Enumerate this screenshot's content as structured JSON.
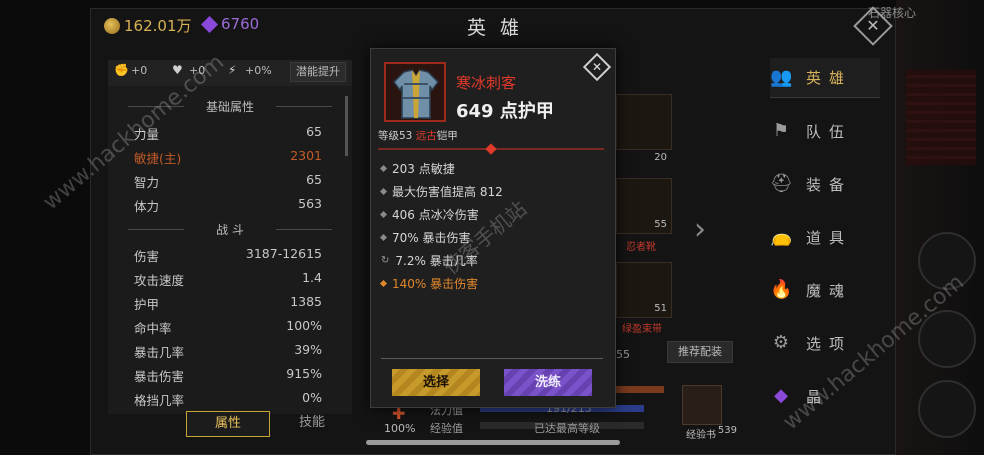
{
  "header": {
    "coins": "162.01万",
    "gems": "6760",
    "title": "英 雄",
    "corner_text": "石器核心"
  },
  "left_panel": {
    "chips": [
      "+0",
      "+0",
      "+0%"
    ],
    "potential_button": "潜能提升",
    "basic_section": "基础属性",
    "basic": [
      {
        "k": "力量",
        "v": "65"
      },
      {
        "k": "敏捷(主)",
        "v": "2301"
      },
      {
        "k": "智力",
        "v": "65"
      },
      {
        "k": "体力",
        "v": "563"
      }
    ],
    "combat_section": "战 斗",
    "combat": [
      {
        "k": "伤害",
        "v": "3187-12615"
      },
      {
        "k": "攻击速度",
        "v": "1.4"
      },
      {
        "k": "护甲",
        "v": "1385"
      },
      {
        "k": "命中率",
        "v": "100%"
      },
      {
        "k": "暴击几率",
        "v": "39%"
      },
      {
        "k": "暴击伤害",
        "v": "915%"
      },
      {
        "k": "格挡几率",
        "v": "0%"
      }
    ],
    "tabs": {
      "attributes": "属性",
      "skills": "技能"
    }
  },
  "middle": {
    "slot1_num": "20",
    "slot2_num": "55",
    "slot2_label": "忍者靴",
    "slot3_num": "51",
    "slot3_label": "绿盈束带",
    "recommend": "推荐配装",
    "partial_num": "55",
    "percent": "100%",
    "stamina_label": "法力值",
    "stamina_value": "191/215",
    "exp_label": "经验值",
    "exp_value": "已达最高等级",
    "book_num": "539",
    "book_label": "经验书"
  },
  "menu": [
    {
      "icon": "hero-icon",
      "glyph": "👥",
      "label": "英雄",
      "active": true
    },
    {
      "icon": "flag-icon",
      "glyph": "⚑",
      "label": "队伍",
      "active": false
    },
    {
      "icon": "helmet-icon",
      "glyph": "⛑",
      "label": "装备",
      "active": false
    },
    {
      "icon": "bag-icon",
      "glyph": "👝",
      "label": "道具",
      "active": false
    },
    {
      "icon": "flame-icon",
      "glyph": "🔥",
      "label": "魔魂",
      "active": false
    },
    {
      "icon": "gear-icon",
      "glyph": "⚙",
      "label": "选项",
      "active": false
    },
    {
      "icon": "crystal-icon",
      "glyph": "◆",
      "label": "晶",
      "active": false
    }
  ],
  "popup": {
    "item_name": "寒冰刺客",
    "armor": "649 点护甲",
    "level_text": "等级53",
    "rarity": "远古",
    "type": "铠甲",
    "attributes": [
      {
        "text": "203 点敏捷",
        "style": "normal"
      },
      {
        "text": "最大伤害值提高 812",
        "style": "normal"
      },
      {
        "text": "406 点冰冷伤害",
        "style": "normal"
      },
      {
        "text": "70% 暴击伤害",
        "style": "normal"
      },
      {
        "text": "7.2% 暴击几率",
        "style": "crit"
      },
      {
        "text": "140% 暴击伤害",
        "style": "gold"
      }
    ],
    "select_button": "选择",
    "wash_button": "洗练"
  },
  "watermarks": [
    "www.hackhome.com",
    "www.hackhome.com",
    "侠客手机站"
  ],
  "colors": {
    "accent_gold": "#d6b25a",
    "rarity_red": "#e0392b",
    "highlight_orange": "#c25a27",
    "wash_purple": "#7a52c9"
  }
}
